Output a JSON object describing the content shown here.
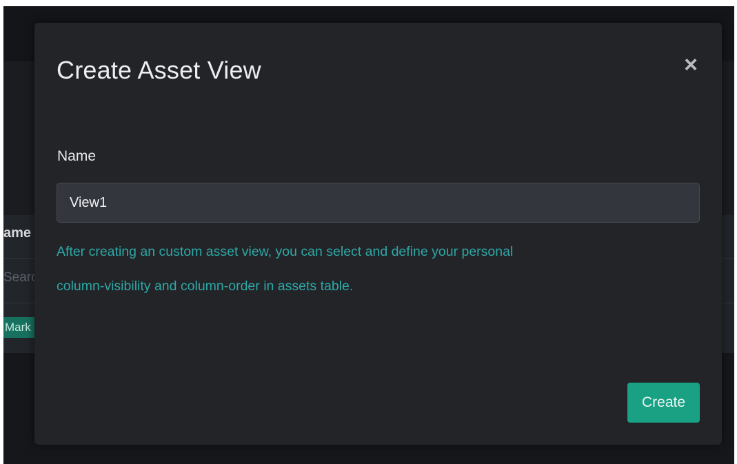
{
  "background": {
    "table_header": "ame",
    "search_placeholder": "Searc",
    "tag_label": "Mark"
  },
  "modal": {
    "title": "Create Asset View",
    "close_icon": "close-icon",
    "close_glyph": "×",
    "name_label": "Name",
    "name_value": "View1",
    "help_text_line1": "After creating an custom asset view, you can select and define your personal",
    "help_text_line2": "column-visibility and column-order in assets table.",
    "create_label": "Create"
  },
  "colors": {
    "accent": "#1aa083",
    "help_text": "#2ea8a6",
    "modal_bg": "#222428"
  }
}
